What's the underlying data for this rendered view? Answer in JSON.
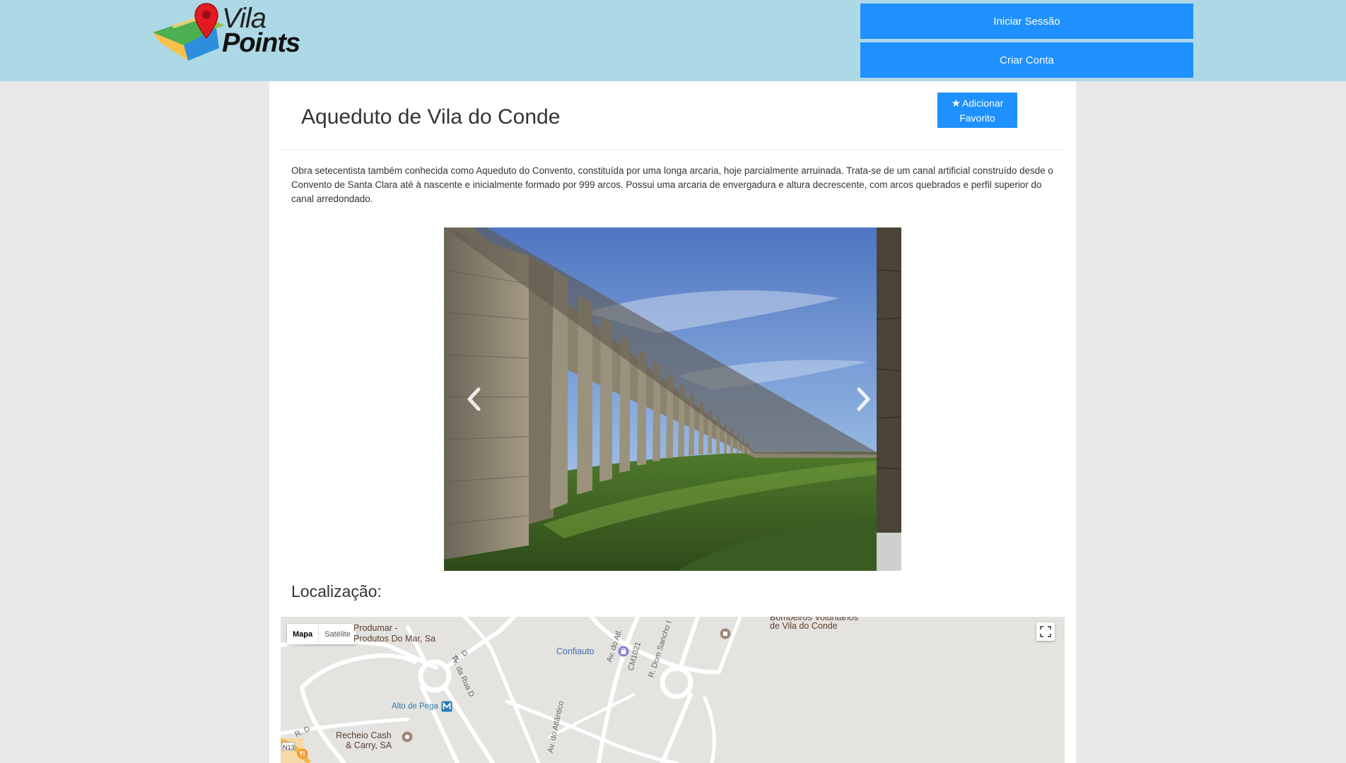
{
  "header": {
    "logo_line1": "Vila",
    "logo_line2": "Points",
    "login_label": "Iniciar Sessão",
    "signup_label": "Criar Conta"
  },
  "page": {
    "title": "Aqueduto de Vila do Conde",
    "favorite_label_line1": "Adicionar",
    "favorite_label_line2": "Favorito",
    "description": "Obra setecentista também conhecida como Aqueduto do Convento, constituída por uma longa arcaria, hoje parcialmente arruinada. Trata-se de um canal artificial construído desde o Convento de Santa Clara até à nascente e inicialmente formado por 999 arcos. Possui uma arcaria de envergadura e altura decrescente, com arcos quebrados e perfil superior do canal arredondado.",
    "location_title": "Localização:"
  },
  "map": {
    "type_map": "Mapa",
    "type_satellite": "Satélite",
    "labels": {
      "produmar_1": "Produmar -",
      "produmar_2": "Produtos Do Mar, Sa",
      "confiauto": "Confiauto",
      "bombeiros_1": "Bombeiros Voluntários",
      "bombeiros_2": "de Vila do Conde",
      "alto_pega": "Alto de Pega",
      "recheio_1": "Recheio Cash",
      "recheio_2": "& Carry, SA",
      "rd_1": "R. D",
      "rd_2": "R. D",
      "tv_rua_d": "Tv. da Rua D",
      "av_atlantico_1": "Av. do Atl.",
      "av_atlantico_2": "Av. do Atlântico",
      "cm1021": "CM1021",
      "dom_sancho": "R. Dom Sancho I",
      "n13": "N13"
    },
    "colors": {
      "land": "#e5e3df",
      "road": "#ffffff",
      "metro": "#2e7bb3"
    }
  },
  "colors": {
    "header_bg": "#add8e6",
    "button_blue": "#1e90ff",
    "page_bg": "#e9e9e9"
  },
  "icons": [
    "map-pin-icon",
    "star-icon",
    "chevron-left-icon",
    "chevron-right-icon",
    "fullscreen-icon",
    "metro-icon",
    "fire-station-icon",
    "shopping-icon",
    "restaurant-icon"
  ]
}
